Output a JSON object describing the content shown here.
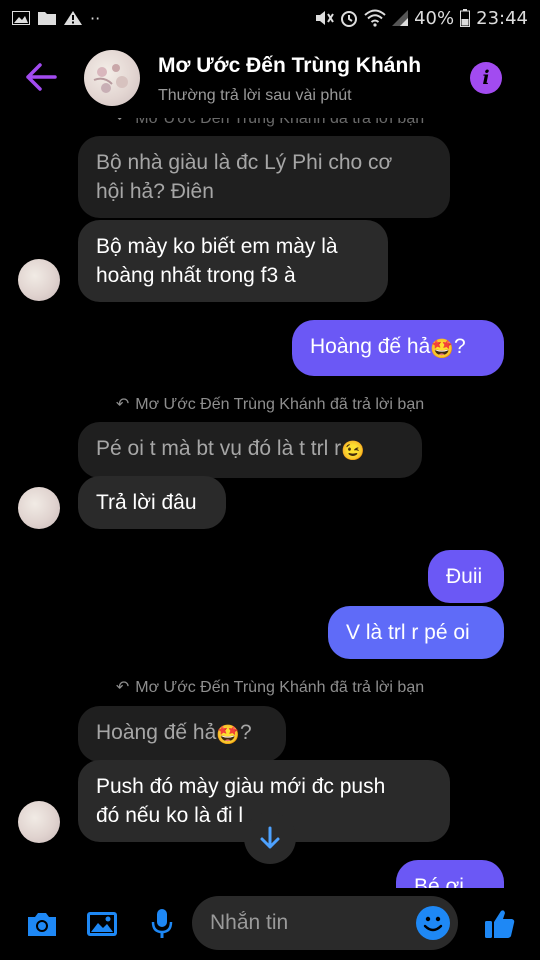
{
  "status_bar": {
    "battery": "40%",
    "time": "23:44"
  },
  "header": {
    "contact_name": "Mơ Ước Đến Trùng Khánh",
    "subtitle": "Thường trả lời sau vài phút",
    "accent_color": "#a24bf0"
  },
  "chat": {
    "reply_note_partial": "Mơ Ước Đến Trùng Khánh đã trả lời bạn",
    "reply_note": "Mơ Ước Đến Trùng Khánh đã trả lời bạn",
    "reply_note_2": "Mơ Ước Đến Trùng Khánh đã trả lời bạn",
    "messages": [
      {
        "text_l1": "Bộ nhà giàu là đc Lý Phi cho cơ",
        "text_l2": "hội hả? Điên"
      },
      {
        "text_l1": "Bộ mày ko biết em mày là",
        "text_l2": "hoàng nhất trong f3 à"
      },
      {
        "text": "Hoàng đế hả",
        "suffix": "?"
      },
      {
        "text": "Pé oi t mà bt vụ đó là t trl r"
      },
      {
        "text": "Trả lời đâu"
      },
      {
        "text": "Đuii"
      },
      {
        "text": "V là trl r pé oi"
      },
      {
        "text": "Hoàng đế hả",
        "suffix": "?"
      },
      {
        "text_l1": "Push đó mày giàu mới đc push",
        "text_l2": "đó nếu ko là đi l"
      },
      {
        "text": "Bé ơi"
      }
    ]
  },
  "composer": {
    "placeholder": "Nhắn tin",
    "icons": [
      "camera-icon",
      "gallery-icon",
      "microphone-icon",
      "emoji-icon",
      "thumbs-up-icon"
    ],
    "accent_color": "#1e88f5"
  }
}
